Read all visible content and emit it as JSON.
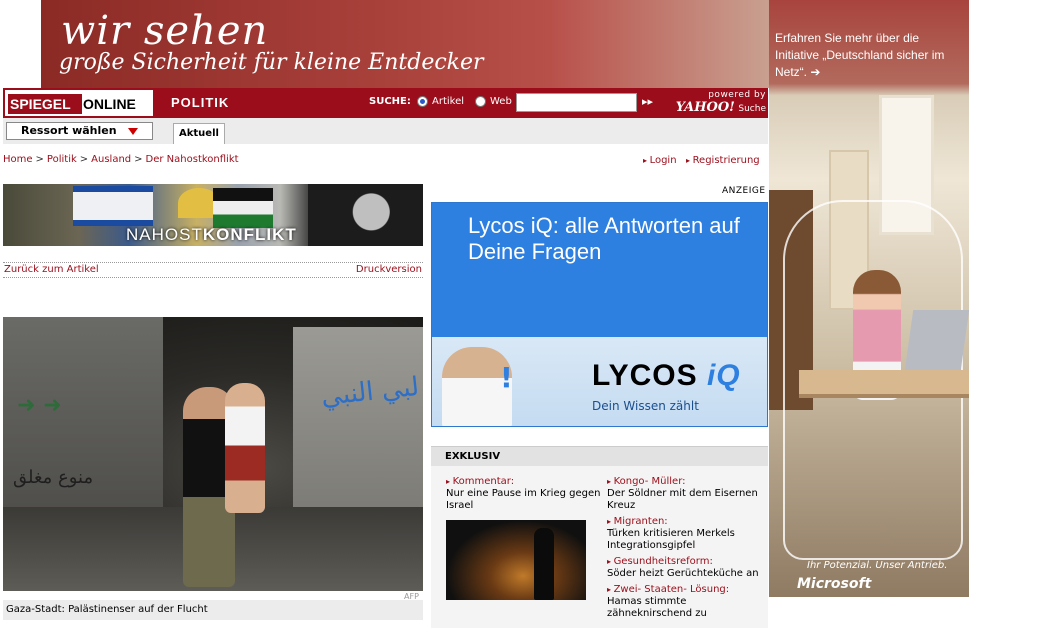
{
  "top_ad": {
    "line1": "wir sehen",
    "line2": "große Sicherheit für kleine Entdecker"
  },
  "side_ad": {
    "text": "Erfahren Sie mehr über die Initiative „Deutschland sicher im Netz“. ➔",
    "tagline": "Ihr Potenzial. Unser Antrieb.",
    "brand": "Microsoft"
  },
  "header": {
    "logo_left": "SPIEGEL",
    "logo_right": "ONLINE",
    "section": "POLITIK",
    "search_label": "SUCHE:",
    "radio_artikel": "Artikel",
    "radio_web": "Web",
    "search_value": "",
    "go_label": "▸▸",
    "powered_by": "powered by",
    "yahoo": "YAHOO!",
    "suche": "Suche"
  },
  "subnav": {
    "ressort_label": "Ressort wählen",
    "tab_aktuell": "Aktuell"
  },
  "breadcrumb": {
    "items": [
      "Home",
      "Politik",
      "Ausland",
      "Der Nahostkonflikt"
    ],
    "separator": ">"
  },
  "account": {
    "login": "Login",
    "register": "Registrierung"
  },
  "nahost_banner": {
    "prefix": "NAHOST",
    "bold": "KONFLIKT"
  },
  "article_links": {
    "back": "Zurück zum Artikel",
    "print": "Druckversion"
  },
  "photo": {
    "credit": "AFP",
    "caption": "Gaza-Stadt: Palästinenser auf der Flucht"
  },
  "ad": {
    "label": "ANZEIGE",
    "headline": "Lycos iQ: alle Antworten auf Deine Fragen",
    "logo_left": "LYCOS",
    "logo_right": "iQ",
    "slogan": "Dein Wissen zählt"
  },
  "exklusiv": {
    "title": "EXKLUSIV",
    "items": [
      {
        "kicker": "Kommentar:",
        "title": "Nur eine Pause im Krieg gegen Israel"
      },
      {
        "kicker": "Kongo- Müller:",
        "title": "Der Söldner mit dem Eisernen Kreuz"
      },
      {
        "kicker": "Migranten:",
        "title": "Türken kritisieren Merkels Integrationsgipfel"
      },
      {
        "kicker": "Gesundheitsreform:",
        "title": "Söder heizt Gerüchteküche an"
      },
      {
        "kicker": "Zwei- Staaten- Lösung:",
        "title": "Hamas stimmte zähneknirschend zu"
      }
    ]
  },
  "colors": {
    "brand_red": "#9b0d1a",
    "lycos_blue": "#2d7fe0",
    "nav_gray": "#ececec"
  }
}
